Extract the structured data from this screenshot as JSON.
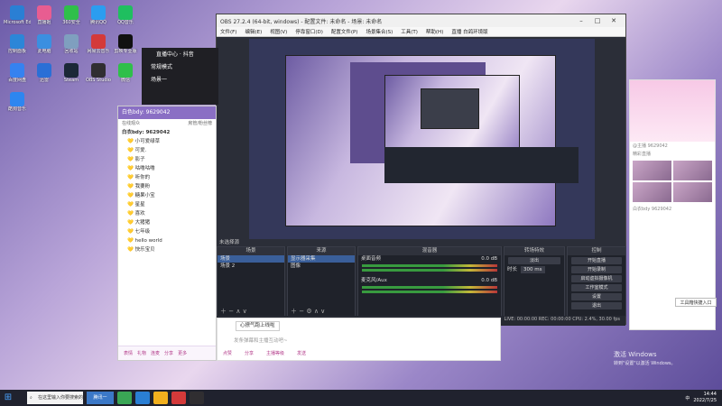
{
  "desktop": {
    "icons": [
      {
        "label": "Microsoft Edge",
        "color": "#2a7fd4"
      },
      {
        "label": "直播姬",
        "color": "#e85d91"
      },
      {
        "label": "360安全",
        "color": "#2fbf4a"
      },
      {
        "label": "腾讯QQ",
        "color": "#2b9df0"
      },
      {
        "label": "QQ音乐",
        "color": "#1fbf5f"
      },
      {
        "label": "控制面板",
        "color": "#2c86d8"
      },
      {
        "label": "此电脑",
        "color": "#3b8fe0"
      },
      {
        "label": "回收站",
        "color": "#7f9fbf"
      },
      {
        "label": "网易云音乐",
        "color": "#d43a3a"
      },
      {
        "label": "剪映专业版",
        "color": "#111111"
      },
      {
        "label": "百度网盘",
        "color": "#3582f0"
      },
      {
        "label": "迅雷",
        "color": "#2a6fd6"
      },
      {
        "label": "Steam",
        "color": "#1b2838"
      },
      {
        "label": "OBS Studio",
        "color": "#302e31"
      },
      {
        "label": "微信",
        "color": "#2fbf4a"
      },
      {
        "label": "酷狗音乐",
        "color": "#2d86f0"
      }
    ]
  },
  "obs": {
    "title": "OBS 27.2.4 (64-bit, windows) - 配置文件: 未命名 - 场景: 未命名",
    "menu": [
      "文件(F)",
      "编辑(E)",
      "视图(V)",
      "停靠窗口(D)",
      "配置文件(P)",
      "场景集合(S)",
      "工具(T)",
      "帮助(H)",
      "直播 白鸽环境版"
    ],
    "docks": {
      "scenes": {
        "title": "场景",
        "items": [
          "场景",
          "场景 2"
        ]
      },
      "sources": {
        "title": "来源",
        "items": [
          "显示器采集",
          "图像"
        ]
      },
      "mixer": {
        "title": "混音器",
        "channels": [
          "桌面音频",
          "麦克风/Aux"
        ],
        "levels": [
          "0.0 dB",
          "0.0 dB"
        ]
      },
      "transitions": {
        "title": "转场特效",
        "type": "淡出",
        "duration_label": "时长",
        "duration": "300 ms"
      },
      "controls": {
        "title": "控制",
        "buttons": [
          "开始直播",
          "开始录制",
          "启动虚拟摄像机",
          "工作室模式",
          "设置",
          "退出"
        ]
      }
    },
    "status": "LIVE: 00:00:00    REC: 00:00:00    CPU: 2.4%, 30.00 fps",
    "source_label": "未选择源"
  },
  "chat": {
    "header": "白色bdy: 9629042",
    "sub_left": "在线观众",
    "sub_right": "房管/粉丝榜",
    "users": [
      "白衣bdy: 9629042",
      "小可爱绿草",
      "可爱.",
      "影子",
      "咕噜咕噜",
      "听你的",
      "我要粉",
      "糖果小宝",
      "星星",
      "喜欢",
      "大猪猪",
      "七年级",
      "hello world",
      "快乐宝贝"
    ],
    "bottom_tools": [
      "表情",
      "礼物",
      "连麦",
      "分享",
      "更多"
    ]
  },
  "stream_menu": {
    "title": "直播中心 · 抖音",
    "items": [
      "常规模式",
      "场景一"
    ]
  },
  "msg_bar": {
    "tip": "心撩气跑上线啦",
    "placeholder": "发条弹幕和主播互动吧~",
    "tools": [
      "点赞",
      "分享",
      "主播等级",
      "发送"
    ]
  },
  "webpage": {
    "texts": [
      "@主播 9629042",
      "精彩直播",
      "白衣bdy 9629042"
    ]
  },
  "toast": "工具箱快捷入口",
  "watermark": {
    "line1": "激活 Windows",
    "line2": "转到\"设置\"以激活 Windows。"
  },
  "taskbar": {
    "search_text": "在这里输入你要搜索的内容",
    "active_app": "腾讯一",
    "time": "14:44",
    "date": "2022/7/25",
    "lang": "中"
  }
}
